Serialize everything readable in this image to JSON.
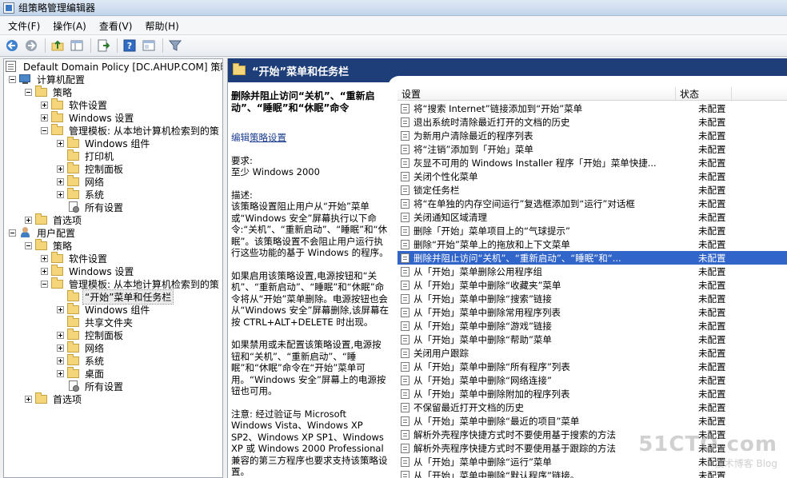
{
  "window": {
    "title": "组策略管理编辑器"
  },
  "menu": [
    {
      "label": "文件(F)"
    },
    {
      "label": "操作(A)"
    },
    {
      "label": "查看(V)"
    },
    {
      "label": "帮助(H)"
    }
  ],
  "toolbar": {
    "icons": [
      "back-arrow-icon",
      "forward-arrow-icon",
      "up-folder-icon",
      "show-hide-tree-icon",
      "export-list-icon",
      "help-icon",
      "properties-icon",
      "filter-icon"
    ]
  },
  "tree": [
    {
      "label": "Default Domain Policy [DC.AHUP.COM] 策略",
      "icon": "policy-icon",
      "expander": "none",
      "indent": 0
    },
    {
      "label": "计算机配置",
      "icon": "computer-icon",
      "expander": "minus",
      "indent": 0
    },
    {
      "label": "策略",
      "icon": "folder-icon",
      "expander": "minus",
      "indent": 1
    },
    {
      "label": "软件设置",
      "icon": "folder-icon",
      "expander": "plus",
      "indent": 2
    },
    {
      "label": "Windows 设置",
      "icon": "folder-icon",
      "expander": "plus",
      "indent": 2
    },
    {
      "label": "管理模板: 从本地计算机检索到的策",
      "icon": "folder-icon",
      "expander": "minus",
      "indent": 2
    },
    {
      "label": "Windows 组件",
      "icon": "folder-icon",
      "expander": "plus",
      "indent": 3
    },
    {
      "label": "打印机",
      "icon": "folder-icon",
      "expander": "none",
      "indent": 3
    },
    {
      "label": "控制面板",
      "icon": "folder-icon",
      "expander": "plus",
      "indent": 3
    },
    {
      "label": "网络",
      "icon": "folder-icon",
      "expander": "plus",
      "indent": 3
    },
    {
      "label": "系统",
      "icon": "folder-icon",
      "expander": "plus",
      "indent": 3
    },
    {
      "label": "所有设置",
      "icon": "settings-doc-icon",
      "expander": "none",
      "indent": 3
    },
    {
      "label": "首选项",
      "icon": "folder-icon",
      "expander": "plus",
      "indent": 1
    },
    {
      "label": "用户配置",
      "icon": "user-icon",
      "expander": "minus",
      "indent": 0
    },
    {
      "label": "策略",
      "icon": "folder-icon",
      "expander": "minus",
      "indent": 1
    },
    {
      "label": "软件设置",
      "icon": "folder-icon",
      "expander": "plus",
      "indent": 2
    },
    {
      "label": "Windows 设置",
      "icon": "folder-icon",
      "expander": "plus",
      "indent": 2
    },
    {
      "label": "管理模板: 从本地计算机检索到的策",
      "icon": "folder-icon",
      "expander": "minus",
      "indent": 2
    },
    {
      "label": "“开始”菜单和任务栏",
      "icon": "folder-icon",
      "expander": "none",
      "indent": 3,
      "selected": true
    },
    {
      "label": "Windows 组件",
      "icon": "folder-icon",
      "expander": "plus",
      "indent": 3
    },
    {
      "label": "共享文件夹",
      "icon": "folder-icon",
      "expander": "none",
      "indent": 3
    },
    {
      "label": "控制面板",
      "icon": "folder-icon",
      "expander": "plus",
      "indent": 3
    },
    {
      "label": "网络",
      "icon": "folder-icon",
      "expander": "plus",
      "indent": 3
    },
    {
      "label": "系统",
      "icon": "folder-icon",
      "expander": "plus",
      "indent": 3
    },
    {
      "label": "桌面",
      "icon": "folder-icon",
      "expander": "plus",
      "indent": 3
    },
    {
      "label": "所有设置",
      "icon": "settings-doc-icon",
      "expander": "none",
      "indent": 3
    },
    {
      "label": "首选项",
      "icon": "folder-icon",
      "expander": "plus",
      "indent": 1
    }
  ],
  "header": {
    "title": "“开始”菜单和任务栏"
  },
  "description": {
    "title": "删除并阻止访问“关机”、“重新启动”、“睡眠”和“休眠”命令",
    "edit_prefix": "编辑",
    "edit_link": "策略设置",
    "requirements_label": "要求:",
    "requirements": "至少 Windows 2000",
    "desc_label": "描述:",
    "paragraphs": [
      "该策略设置阻止用户从“开始”菜单或“Windows 安全”屏幕执行以下命令:“关机”、“重新启动”、“睡眠”和“休眠”。该策略设置不会阻止用户运行执行这些功能的基于 Windows 的程序。",
      "如果启用该策略设置,电源按钮和“关机”、“重新启动”、“睡眠”和“休眠”命令将从“开始”菜单删除。电源按钮也会从“Windows 安全”屏幕删除,该屏幕在按 CTRL+ALT+DELETE 时出现。",
      "如果禁用或未配置该策略设置,电源按钮和“关机”、“重新启动”、“睡眠”和“休眠”命令在“开始”菜单可用。“Windows 安全”屏幕上的电源按钮也可用。",
      "注意: 经过验证与 Microsoft Windows Vista、Windows XP SP2、Windows XP SP1、Windows XP 或 Windows 2000 Professional 兼容的第三方程序也要求支持该策略设置。"
    ]
  },
  "list": {
    "col_setting": "设置",
    "col_state": "状态",
    "rows": [
      {
        "setting": "将“搜索 Internet”链接添加到“开始”菜单",
        "state": "未配置"
      },
      {
        "setting": "退出系统时清除最近打开的文档的历史",
        "state": "未配置"
      },
      {
        "setting": "为新用户清除最近的程序列表",
        "state": "未配置"
      },
      {
        "setting": "将“注销”添加到「开始」菜单",
        "state": "未配置"
      },
      {
        "setting": "灰显不可用的 Windows Installer 程序「开始」菜单快捷...",
        "state": "未配置"
      },
      {
        "setting": "关闭个性化菜单",
        "state": "未配置"
      },
      {
        "setting": "锁定任务栏",
        "state": "未配置"
      },
      {
        "setting": "将“在单独的内存空间运行”复选框添加到“运行”对话框",
        "state": "未配置"
      },
      {
        "setting": "关闭通知区域清理",
        "state": "未配置"
      },
      {
        "setting": "删除「开始」菜单项目上的“气球提示”",
        "state": "未配置"
      },
      {
        "setting": "删除“开始”菜单上的拖放和上下文菜单",
        "state": "未配置"
      },
      {
        "setting": "删除并阻止访问“关机”、“重新启动”、“睡眠”和“...",
        "state": "未配置",
        "selected": true
      },
      {
        "setting": "从「开始」菜单删除公用程序组",
        "state": "未配置"
      },
      {
        "setting": "从「开始」菜单中删除“收藏夹”菜单",
        "state": "未配置"
      },
      {
        "setting": "从「开始」菜单中删除“搜索”链接",
        "state": "未配置"
      },
      {
        "setting": "从「开始」菜单中删除常用程序列表",
        "state": "未配置"
      },
      {
        "setting": "从「开始」菜单中删除“游戏”链接",
        "state": "未配置"
      },
      {
        "setting": "从「开始」菜单中删除“帮助”菜单",
        "state": "未配置"
      },
      {
        "setting": "关闭用户跟踪",
        "state": "未配置"
      },
      {
        "setting": "从「开始」菜单中删除“所有程序”列表",
        "state": "未配置"
      },
      {
        "setting": "从「开始」菜单中删除“网络连接”",
        "state": "未配置"
      },
      {
        "setting": "从「开始」菜单中删除附加的程序列表",
        "state": "未配置"
      },
      {
        "setting": "不保留最近打开文档的历史",
        "state": "未配置"
      },
      {
        "setting": "从「开始」菜单中删除“最近的项目”菜单",
        "state": "未配置"
      },
      {
        "setting": "解析外壳程序快捷方式时不要使用基于搜索的方法",
        "state": "未配置"
      },
      {
        "setting": "解析外壳程序快捷方式时不要使用基于跟踪的方法",
        "state": "未配置"
      },
      {
        "setting": "从「开始」菜单中删除“运行”菜单",
        "state": "未配置"
      },
      {
        "setting": "从「开始」菜单中删除“默认程序”链接。",
        "state": "未配置"
      }
    ]
  },
  "watermark": {
    "main": "51CTO.com",
    "sub": "技术博客  Blog"
  }
}
